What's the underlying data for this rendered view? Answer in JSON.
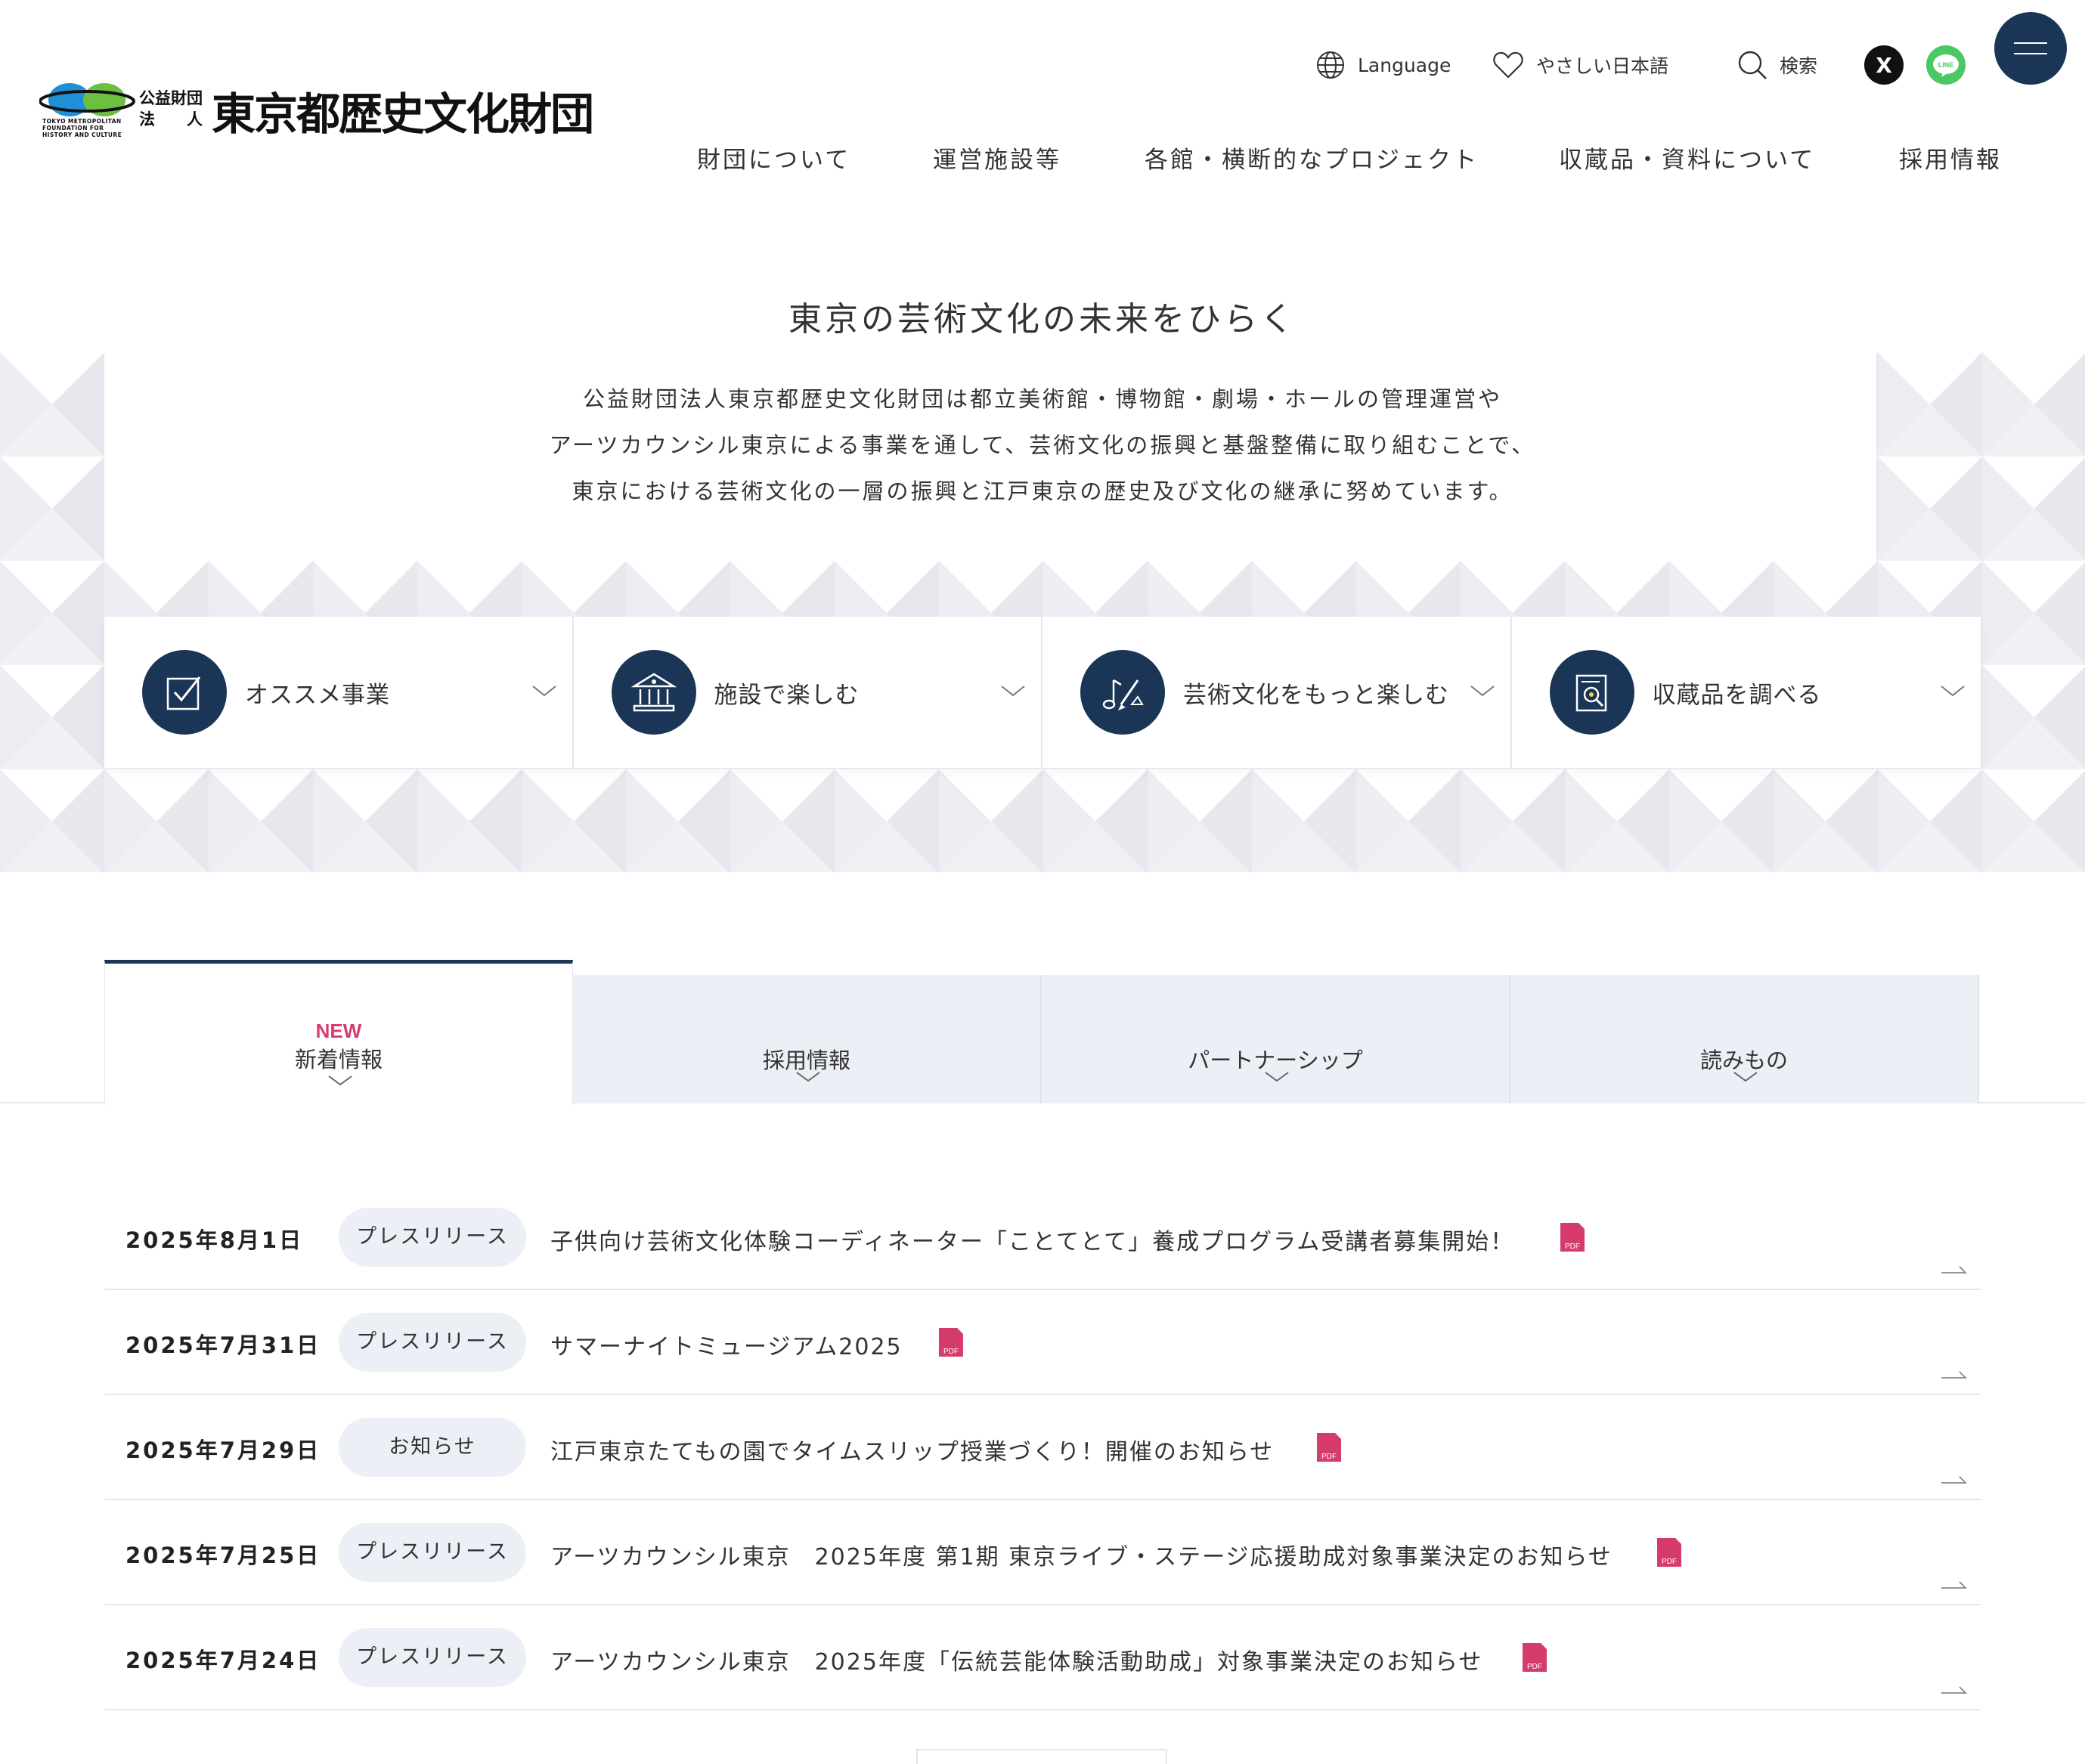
{
  "header": {
    "logo": {
      "small_line1": "公益財団",
      "small_line2": "法　　人",
      "name": "東京都歴史文化財団",
      "english": "TOKYO METROPOLITAN FOUNDATION FOR HISTORY AND CULTURE"
    },
    "utility": {
      "language_label": "Language",
      "easy_japanese_label": "やさしい日本語",
      "search_label": "検索"
    },
    "sns": {
      "x_label": "X",
      "line_label": "LINE"
    },
    "global_nav": [
      "財団について",
      "運営施設等",
      "各館・横断的なプロジェクト",
      "収蔵品・資料について",
      "採用情報"
    ]
  },
  "hero": {
    "tagline": "東京の芸術文化の未来をひらく",
    "intro_lines": [
      "公益財団法人東京都歴史文化財団は都立美術館・博物館・劇場・ホールの管理運営や",
      "アーツカウンシル東京による事業を通して、芸術文化の振興と基盤整備に取り組むことで、",
      "東京における芸術文化の一層の振興と江戸東京の歴史及び文化の継承に努めています。"
    ]
  },
  "cards": [
    {
      "label": "オススメ事業",
      "icon": "checkbox-icon"
    },
    {
      "label": "施設で楽しむ",
      "icon": "museum-building-icon"
    },
    {
      "label": "芸術文化をもっと楽しむ",
      "icon": "music-paint-icon"
    },
    {
      "label": "収蔵品を調べる",
      "icon": "document-search-icon"
    }
  ],
  "tabs": {
    "new_badge": "NEW",
    "items": [
      "新着情報",
      "採用情報",
      "パートナーシップ",
      "読みもの"
    ]
  },
  "news": [
    {
      "date": "2025年8月1日",
      "category": "プレスリリース",
      "title": "子供向け芸術文化体験コーディネーター「ことてとて」養成プログラム受講者募集開始！",
      "pdf": "PDF"
    },
    {
      "date": "2025年7月31日",
      "category": "プレスリリース",
      "title": "サマーナイトミュージアム2025",
      "pdf": "PDF"
    },
    {
      "date": "2025年7月29日",
      "category": "お知らせ",
      "title": "江戸東京たてもの園でタイムスリップ授業づくり！開催のお知らせ",
      "pdf": "PDF"
    },
    {
      "date": "2025年7月25日",
      "category": "プレスリリース",
      "title": "アーツカウンシル東京　2025年度 第1期 東京ライブ・ステージ応援助成対象事業決定のお知らせ",
      "pdf": "PDF"
    },
    {
      "date": "2025年7月24日",
      "category": "プレスリリース",
      "title": "アーツカウンシル東京　2025年度「伝統芸能体験活動助成」対象事業決定のお知らせ",
      "pdf": "PDF"
    }
  ],
  "colors": {
    "navy": "#1b3557",
    "pink": "#d63c6b",
    "tab_bg": "#eceff6",
    "line_green": "#4cc764"
  }
}
